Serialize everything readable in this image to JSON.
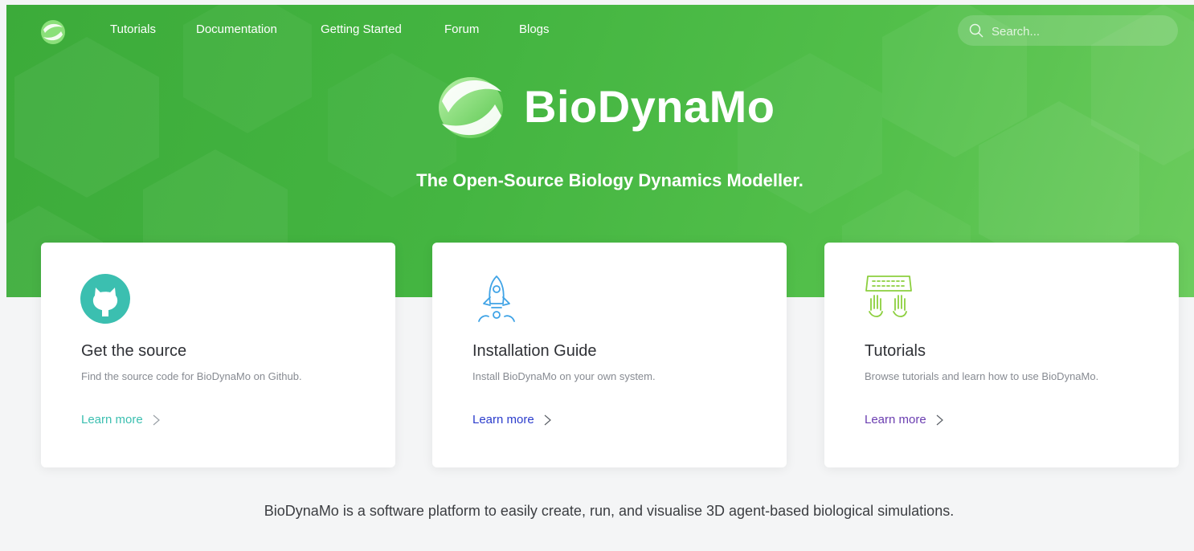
{
  "nav": {
    "logo_icon": "biodynamo-logo-icon",
    "links": [
      "Tutorials",
      "Documentation",
      "Getting Started",
      "Forum",
      "Blogs"
    ]
  },
  "search": {
    "placeholder": "Search...",
    "value": "",
    "icon": "search-icon"
  },
  "hero": {
    "brand_name": "BioDynaMo",
    "tagline": "The Open-Source Biology Dynamics Modeller.",
    "background_color": "#44b541"
  },
  "cards": [
    {
      "icon": "github-icon",
      "title": "Get the source",
      "description": "Find the source code for BioDynaMo on Github.",
      "link_label": "Learn more",
      "link_color": "#3bbfb0"
    },
    {
      "icon": "rocket-icon",
      "title": "Installation Guide",
      "description": "Install BioDynaMo on your own system.",
      "link_label": "Learn more",
      "link_color": "#2b3ccc"
    },
    {
      "icon": "keyboard-hands-icon",
      "title": "Tutorials",
      "description": "Browse tutorials and learn how to use BioDynaMo.",
      "link_label": "Learn more",
      "link_color": "#6a3db0"
    }
  ],
  "footer_text": "BioDynaMo is a software platform to easily create, run, and visualise 3D agent-based biological simulations."
}
